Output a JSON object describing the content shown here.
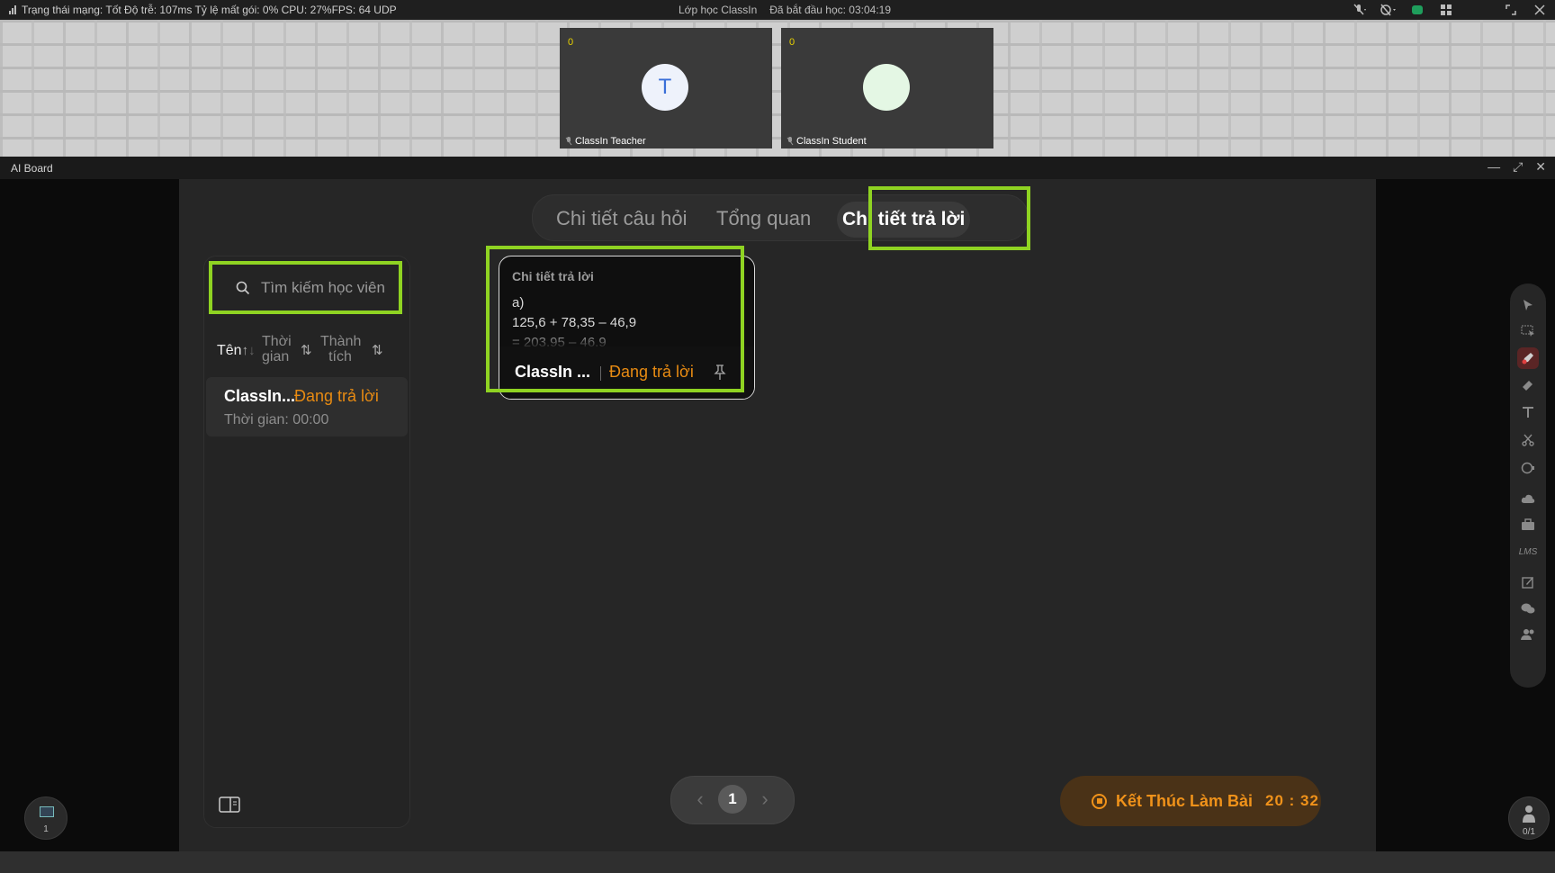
{
  "status_bar": {
    "network_text": "Trạng thái mạng: Tốt Độ trễ: 107ms Tỷ lệ mất gói: 0%  CPU: 27%FPS: 64 UDP",
    "class_name": "Lớp học ClassIn",
    "elapsed": "Đã bắt đầu học: 03:04:19"
  },
  "videos": [
    {
      "count": "0",
      "avatar_letter": "T",
      "name": "ClassIn Teacher",
      "avatar_color": "#eef2fb"
    },
    {
      "count": "0",
      "avatar_letter": "",
      "name": "ClassIn Student",
      "avatar_color": "#e4f7e4"
    }
  ],
  "board": {
    "title": "AI Board",
    "tabs": [
      "Chi tiết câu hỏi",
      "Tổng quan",
      "Chi tiết trả lời"
    ],
    "active_tab": "Chi tiết trả lời"
  },
  "sidebar": {
    "search_placeholder": "Tìm kiếm học viên",
    "sort": {
      "name": "Tên",
      "time": "Thời\ngian",
      "score": "Thành\ntích"
    },
    "students": [
      {
        "name": "ClassIn...",
        "status": "Đang trả lời",
        "time": "Thời gian: 00:00"
      }
    ]
  },
  "answer_card": {
    "title": "Chi tiết trả lời",
    "lines": "a)\n125,6 + 78,35 – 46,9\n= 203,95 – 46,9",
    "student": "ClassIn ...",
    "status": "Đang trả lời"
  },
  "pagination": {
    "current": "1"
  },
  "end_button": {
    "label": "Kết Thúc Làm Bài",
    "timer": "20 : 32"
  },
  "corner": {
    "page_index": "1",
    "hands_up": "0/1"
  },
  "colors": {
    "accent_highlight": "#8fd322",
    "status_orange": "#e88b12",
    "end_button_bg": "#4a3217"
  }
}
